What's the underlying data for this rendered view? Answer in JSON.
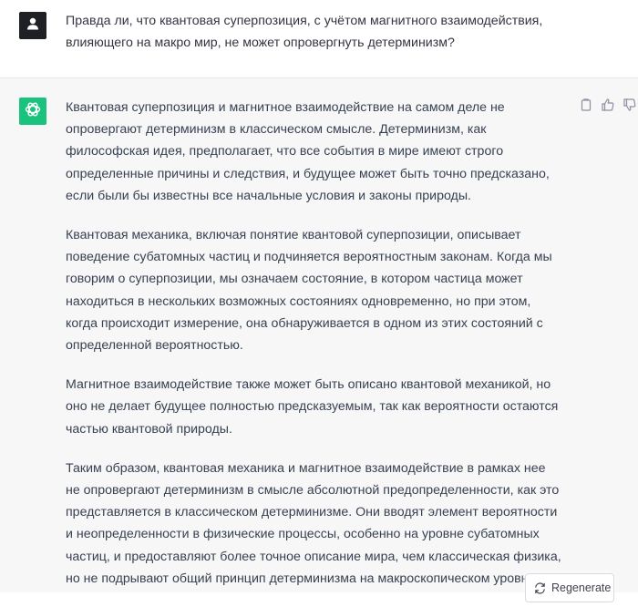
{
  "user_message": {
    "avatar_icon": "user-icon",
    "text": "Правда ли, что квантовая суперпозиция, с учётом магнитного взаимодействия, влияющего на макро мир, не может опровергнуть детерминизм?"
  },
  "assistant_message": {
    "avatar_icon": "openai-logo-icon",
    "accent_color": "#19c37d",
    "paragraphs": [
      "Квантовая суперпозиция и магнитное взаимодействие на самом деле не опровергают детерминизм в классическом смысле. Детерминизм, как философская идея, предполагает, что все события в мире имеют строго определенные причины и следствия, и будущее может быть точно предсказано, если были бы известны все начальные условия и законы природы.",
      "Квантовая механика, включая понятие квантовой суперпозиции, описывает поведение субатомных частиц и подчиняется вероятностным законам. Когда мы говорим о суперпозиции, мы означаем состояние, в котором частица может находиться в нескольких возможных состояниях одновременно, но при этом, когда происходит измерение, она обнаруживается в одном из этих состояний с определенной вероятностью.",
      "Магнитное взаимодействие также может быть описано квантовой механикой, но оно не делает будущее полностью предсказуемым, так как вероятности остаются частью квантовой природы.",
      "Таким образом, квантовая механика и магнитное взаимодействие в рамках нее не опровергают детерминизм в смысле абсолютной предопределенности, как это представляется в классическом детерминизме. Они вводят элемент вероятности и неопределенности в физические процессы, особенно на уровне субатомных частиц, и предоставляют более точное описание мира, чем классическая физика, но не подрывают общий принцип детерминизма на макроскопическом уровне."
    ],
    "actions": [
      "copy-icon",
      "thumbs-up-icon",
      "thumbs-down-icon"
    ]
  },
  "regenerate": {
    "label": "Regenerate",
    "icon": "refresh-icon"
  }
}
